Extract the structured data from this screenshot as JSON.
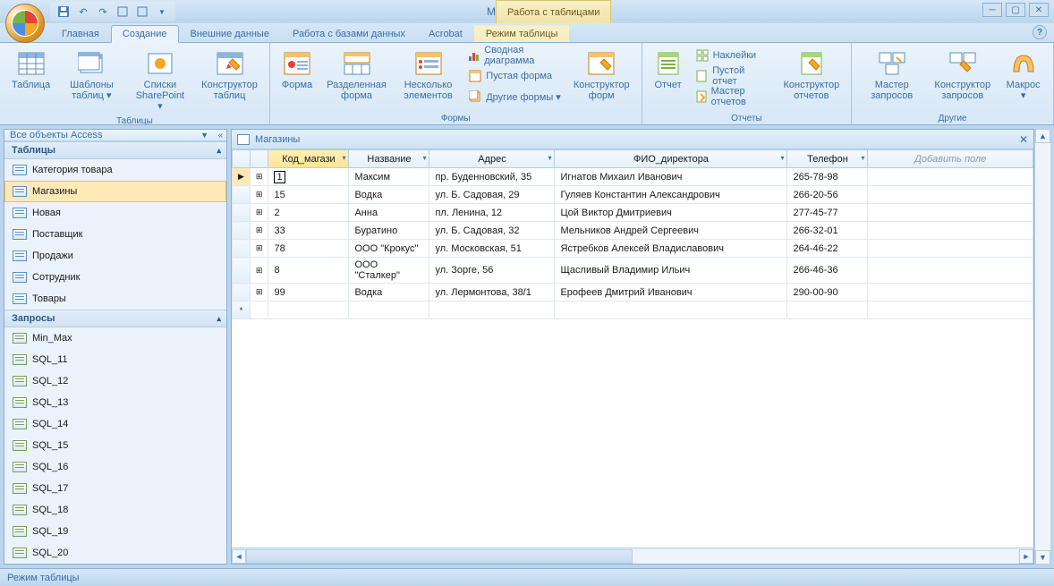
{
  "app_title": "Microsoft Access",
  "contextual_tab_group": "Работа с таблицами",
  "tabs": [
    "Главная",
    "Создание",
    "Внешние данные",
    "Работа с базами данных",
    "Acrobat",
    "Режим таблицы"
  ],
  "active_tab_index": 1,
  "ribbon": {
    "groups": [
      {
        "label": "Таблицы",
        "big": [
          {
            "label": "Таблица"
          },
          {
            "label": "Шаблоны таблиц ▾"
          },
          {
            "label": "Списки SharePoint ▾"
          },
          {
            "label": "Конструктор таблиц"
          }
        ]
      },
      {
        "label": "Формы",
        "big": [
          {
            "label": "Форма"
          },
          {
            "label": "Разделенная форма"
          },
          {
            "label": "Несколько элементов"
          }
        ],
        "small": [
          {
            "label": "Сводная диаграмма"
          },
          {
            "label": "Пустая форма"
          },
          {
            "label": "Другие формы ▾"
          }
        ],
        "big2": [
          {
            "label": "Конструктор форм"
          }
        ]
      },
      {
        "label": "Отчеты",
        "big": [
          {
            "label": "Отчет"
          }
        ],
        "small": [
          {
            "label": "Наклейки"
          },
          {
            "label": "Пустой отчет"
          },
          {
            "label": "Мастер отчетов"
          }
        ],
        "big2": [
          {
            "label": "Конструктор отчетов"
          }
        ]
      },
      {
        "label": "Другие",
        "big": [
          {
            "label": "Мастер запросов"
          },
          {
            "label": "Конструктор запросов"
          },
          {
            "label": "Макрос ▾"
          }
        ]
      }
    ]
  },
  "nav": {
    "header": "Все объекты Access",
    "sections": [
      {
        "title": "Таблицы",
        "items": [
          "Категория товара",
          "Магазины",
          "Новая",
          "Поставщик",
          "Продажи",
          "Сотрудник",
          "Товары"
        ],
        "selected_index": 1
      },
      {
        "title": "Запросы",
        "items": [
          "Min_Max",
          "SQL_11",
          "SQL_12",
          "SQL_13",
          "SQL_14",
          "SQL_15",
          "SQL_16",
          "SQL_17",
          "SQL_18",
          "SQL_19",
          "SQL_20"
        ]
      }
    ]
  },
  "document": {
    "title": "Магазины",
    "columns": [
      "Код_магази",
      "Название",
      "Адрес",
      "ФИО_директора",
      "Телефон"
    ],
    "add_field": "Добавить поле",
    "sorted_col": 0,
    "rows": [
      {
        "cells": [
          "1",
          "Максим",
          "пр. Буденновский, 35",
          "Игнатов Михаил Иванович",
          "265-78-98"
        ],
        "current": true
      },
      {
        "cells": [
          "15",
          "Водка",
          "ул. Б. Садовая, 29",
          "Гуляев Константин Александрович",
          "266-20-56"
        ]
      },
      {
        "cells": [
          "2",
          "Анна",
          "пл. Ленина, 12",
          "Цой Виктор Дмитриевич",
          "277-45-77"
        ]
      },
      {
        "cells": [
          "33",
          "Буратино",
          "ул. Б. Садовая, 32",
          "Мельников Андрей Сергеевич",
          "266-32-01"
        ]
      },
      {
        "cells": [
          "78",
          "ООО \"Крокус\"",
          "ул. Московская, 51",
          "Ястребков Алексей Владиславович",
          "264-46-22"
        ]
      },
      {
        "cells": [
          "8",
          "ООО \"Сталкер\"",
          "ул. Зорге, 56",
          "Щасливый Владимир Ильич",
          "266-46-36"
        ]
      },
      {
        "cells": [
          "99",
          "Водка",
          "ул. Лермонтова, 38/1",
          "Ерофеев Дмитрий Иванович",
          "290-00-90"
        ]
      }
    ]
  },
  "status": "Режим таблицы"
}
